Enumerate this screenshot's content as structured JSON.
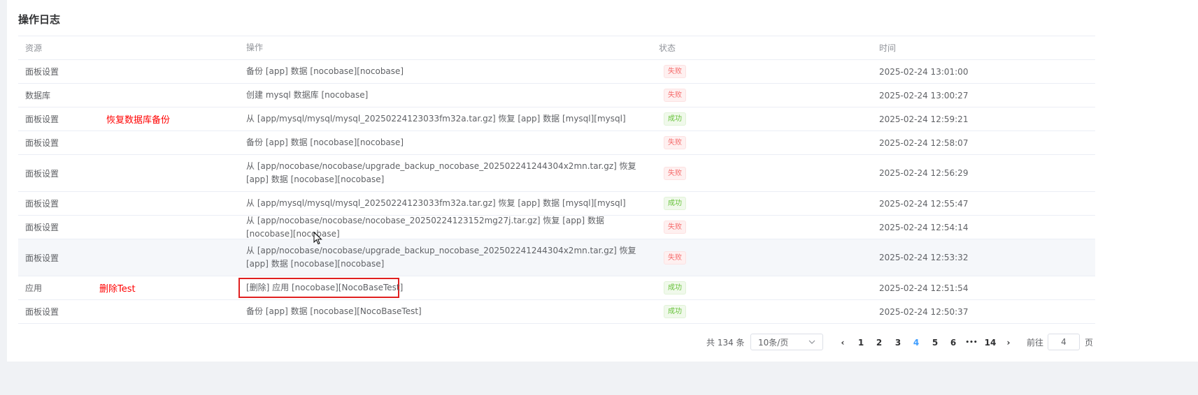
{
  "title": "操作日志",
  "columns": {
    "resource": "资源",
    "operation": "操作",
    "status": "状态",
    "time": "时间"
  },
  "rows": [
    {
      "resource": "面板设置",
      "operation": "备份 [app] 数据 [nocobase][nocobase]",
      "status": "失败",
      "time": "2025-02-24 13:01:00"
    },
    {
      "resource": "数据库",
      "operation": "创建 mysql 数据库 [nocobase]",
      "status": "失败",
      "time": "2025-02-24 13:00:27"
    },
    {
      "resource": "面板设置",
      "operation": "从 [app/mysql/mysql/mysql_20250224123033fm32a.tar.gz] 恢复 [app] 数据 [mysql][mysql]",
      "status": "成功",
      "time": "2025-02-24 12:59:21"
    },
    {
      "resource": "面板设置",
      "operation": "备份 [app] 数据 [nocobase][nocobase]",
      "status": "失败",
      "time": "2025-02-24 12:58:07"
    },
    {
      "resource": "面板设置",
      "operation": "从 [app/nocobase/nocobase/upgrade_backup_nocobase_202502241244304x2mn.tar.gz] 恢复 [app] 数据 [nocobase][nocobase]",
      "status": "失败",
      "time": "2025-02-24 12:56:29"
    },
    {
      "resource": "面板设置",
      "operation": "从 [app/mysql/mysql/mysql_20250224123033fm32a.tar.gz] 恢复 [app] 数据 [mysql][mysql]",
      "status": "成功",
      "time": "2025-02-24 12:55:47"
    },
    {
      "resource": "面板设置",
      "operation": "从 [app/nocobase/nocobase/nocobase_20250224123152mg27j.tar.gz] 恢复 [app] 数据 [nocobase][nocobase]",
      "status": "失败",
      "time": "2025-02-24 12:54:14"
    },
    {
      "resource": "面板设置",
      "operation": "从 [app/nocobase/nocobase/upgrade_backup_nocobase_202502241244304x2mn.tar.gz] 恢复 [app] 数据 [nocobase][nocobase]",
      "status": "失败",
      "time": "2025-02-24 12:53:32"
    },
    {
      "resource": "应用",
      "operation": "[删除] 应用 [nocobase][NocoBaseTest]",
      "status": "成功",
      "time": "2025-02-24 12:51:54"
    },
    {
      "resource": "面板设置",
      "operation": "备份 [app] 数据 [nocobase][NocoBaseTest]",
      "status": "成功",
      "time": "2025-02-24 12:50:37"
    }
  ],
  "annotations": {
    "restore_db_backup": "恢复数据库备份",
    "delete_test": "删除Test"
  },
  "pagination": {
    "total": "共 134 条",
    "page_size": "10条/页",
    "prev": "‹",
    "pages": [
      "1",
      "2",
      "3",
      "4",
      "5",
      "6",
      "•••",
      "14"
    ],
    "current": "4",
    "next": "›",
    "goto_label": "前往",
    "goto_value": "4",
    "page_word": "页"
  },
  "colors": {
    "fail": "#f56c6c",
    "success": "#67c23a",
    "accent": "#409eff",
    "annotation": "#ff0000"
  }
}
